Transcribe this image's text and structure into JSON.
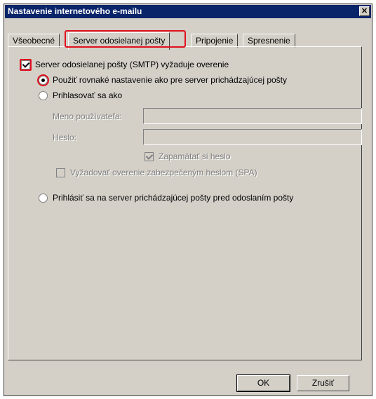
{
  "window": {
    "title": "Nastavenie internetového e-mailu",
    "close_glyph": "✕"
  },
  "tabs": [
    {
      "label": "Všeobecné",
      "active": false
    },
    {
      "label": "Server odosielanej pošty",
      "active": true
    },
    {
      "label": "Pripojenie",
      "active": false
    },
    {
      "label": "Spresnenie",
      "active": false
    }
  ],
  "smtp": {
    "requires_auth_label": "Server odosielanej pošty (SMTP) vyžaduje overenie",
    "requires_auth_checked": true,
    "same_settings_label": "Použiť rovnaké nastavenie ako pre server prichádzajúcej pošty",
    "same_settings_selected": true,
    "login_as_label": "Prihlasovať sa ako",
    "login_as_selected": false,
    "username_label": "Meno používateľa:",
    "username_value": "",
    "password_label": "Heslo:",
    "password_value": "",
    "remember_password_label": "Zapamätať si heslo",
    "remember_password_checked": true,
    "spa_label": "Vyžadovať overenie zabezpečeným heslom (SPA)",
    "spa_checked": false,
    "login_before_send_label": "Prihlásiť sa na server prichádzajúcej pošty pred odoslaním pošty",
    "login_before_send_selected": false
  },
  "buttons": {
    "ok_label": "OK",
    "cancel_label": "Zrušiť"
  },
  "colors": {
    "highlight": "#e0101e",
    "titlebar": "#0a246a",
    "dialog_bg": "#d4d0c8"
  }
}
